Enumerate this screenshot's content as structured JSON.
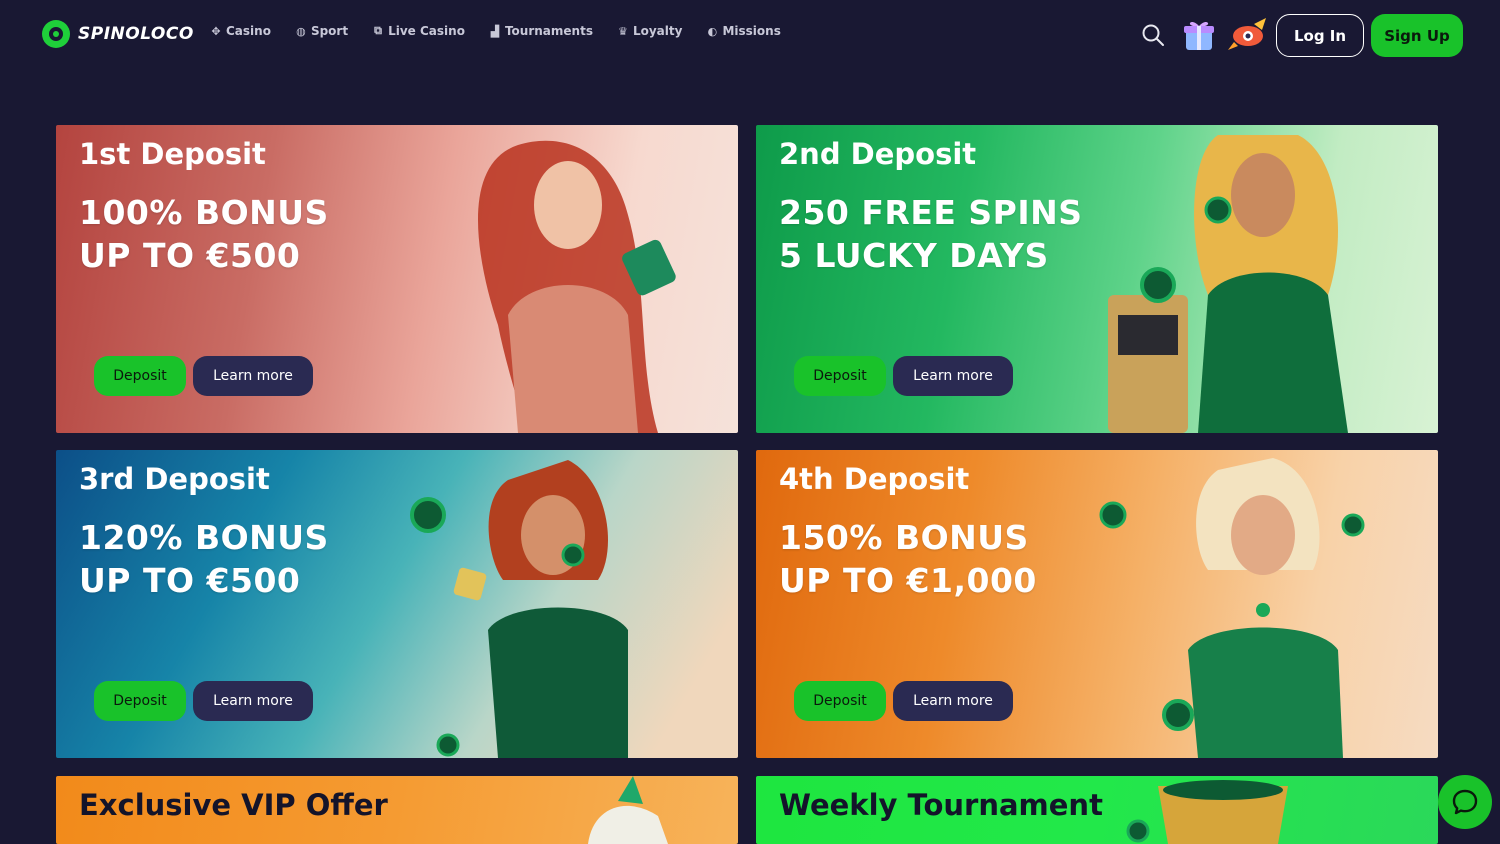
{
  "brand": {
    "name": "SPINOLOCO",
    "accent": "#19c22a",
    "background": "#191833"
  },
  "nav": [
    {
      "label": "Casino",
      "icon": "casino-icon"
    },
    {
      "label": "Sport",
      "icon": "sport-icon"
    },
    {
      "label": "Live Casino",
      "icon": "live-casino-icon"
    },
    {
      "label": "Tournaments",
      "icon": "tournaments-icon"
    },
    {
      "label": "Loyalty",
      "icon": "crown-icon"
    },
    {
      "label": "Missions",
      "icon": "missions-icon"
    }
  ],
  "header": {
    "login_label": "Log In",
    "signup_label": "Sign Up"
  },
  "promos": [
    {
      "title": "1st Deposit",
      "line1": "100% BONUS",
      "line2": "UP TO €500",
      "deposit_label": "Deposit",
      "learn_label": "Learn more"
    },
    {
      "title": "2nd Deposit",
      "line1": "250 FREE SPINS",
      "line2": "5 LUCKY DAYS",
      "deposit_label": "Deposit",
      "learn_label": "Learn more"
    },
    {
      "title": "3rd Deposit",
      "line1": "120% BONUS",
      "line2": "UP TO €500",
      "deposit_label": "Deposit",
      "learn_label": "Learn more"
    },
    {
      "title": "4th Deposit",
      "line1": "150% BONUS",
      "line2": "UP TO €1,000",
      "deposit_label": "Deposit",
      "learn_label": "Learn more"
    },
    {
      "title": "Exclusive VIP Offer"
    },
    {
      "title": "Weekly Tournament"
    }
  ]
}
